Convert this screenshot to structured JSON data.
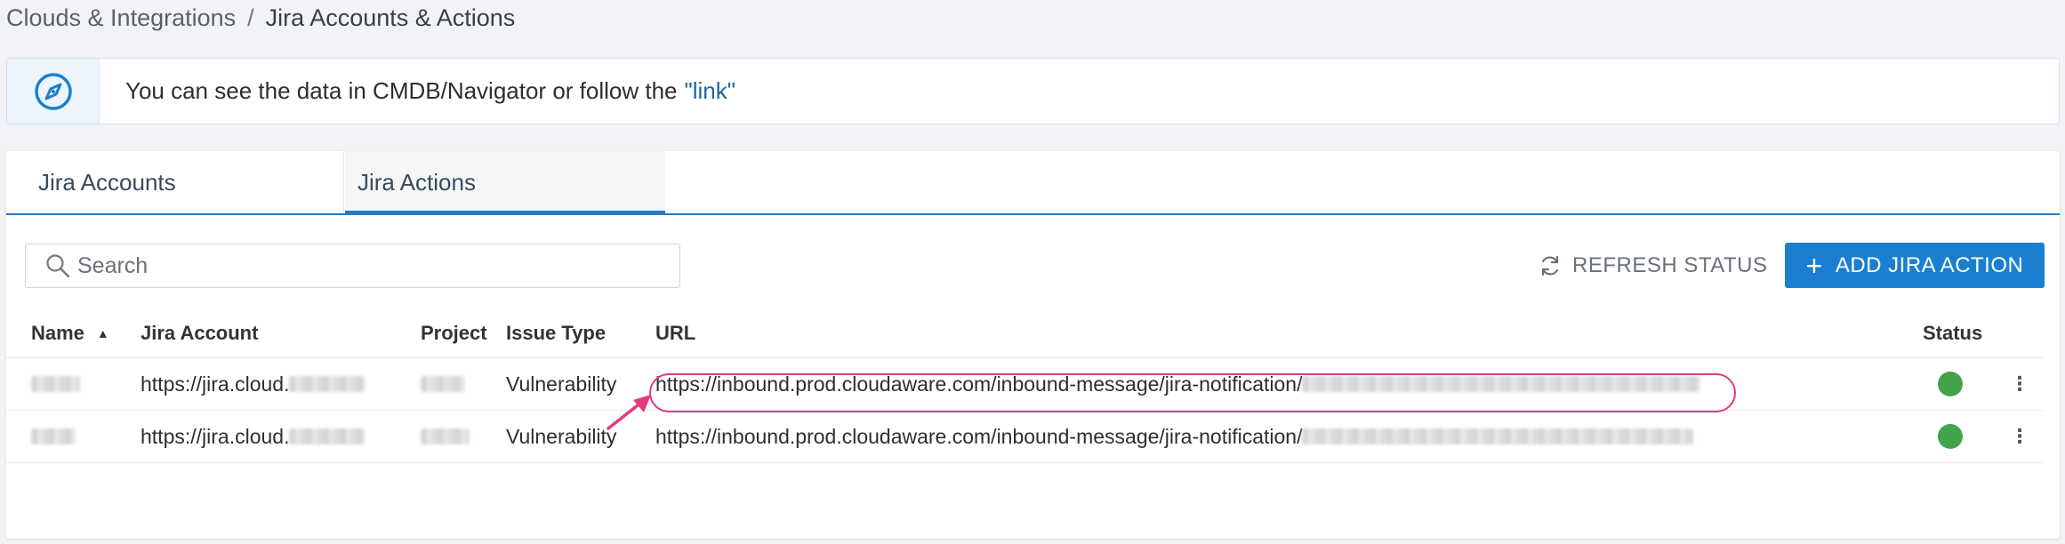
{
  "breadcrumb": {
    "parent": "Clouds & Integrations",
    "separator": "/",
    "current": "Jira Accounts & Actions"
  },
  "banner": {
    "icon": "compass-icon",
    "message": "You can see the data in CMDB/Navigator or follow the",
    "link_text": "\"link\""
  },
  "tabs": [
    {
      "label": "Jira Accounts",
      "active": false
    },
    {
      "label": "Jira Actions",
      "active": true
    }
  ],
  "toolbar": {
    "search_placeholder": "Search",
    "refresh_label": "REFRESH STATUS",
    "add_label": "ADD JIRA ACTION"
  },
  "table": {
    "columns": [
      "Name",
      "Jira Account",
      "Project",
      "Issue Type",
      "URL",
      "Status"
    ],
    "sort_column": "Name",
    "sort_direction": "ascending",
    "rows": [
      {
        "jira_account": "https://jira.cloud.",
        "issue_type": "Vulnerability",
        "url": "https://inbound.prod.cloudaware.com/inbound-message/jira-notification/",
        "status": "active",
        "highlighted": true
      },
      {
        "jira_account": "https://jira.cloud.",
        "issue_type": "Vulnerability",
        "url": "https://inbound.prod.cloudaware.com/inbound-message/jira-notification/",
        "status": "active",
        "highlighted": false
      }
    ]
  },
  "colors": {
    "accent": "#1a7fd1",
    "status_ok": "#41a34a",
    "highlight": "#e23a7e",
    "link": "#1b63a9"
  }
}
